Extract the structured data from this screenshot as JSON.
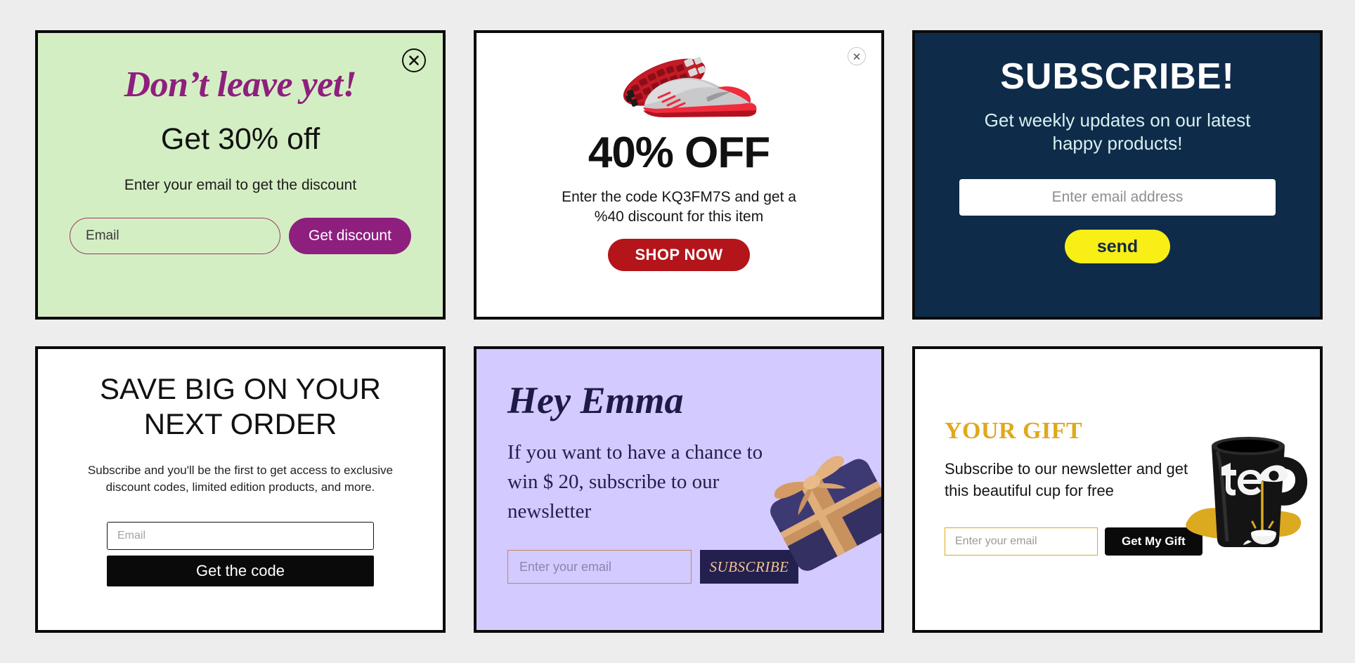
{
  "page": {
    "background_color": "#ededed"
  },
  "cards": [
    {
      "id": "dont-leave-yet",
      "background_color": "#d4eec4",
      "heading": "Don’t leave yet!",
      "subheading": "Get 30% off",
      "body": "Enter your email to get the discount",
      "input_placeholder": "Email",
      "input_value": "",
      "button_label": "Get discount",
      "accent_color": "#8e1f7e",
      "close_icon": "close-icon"
    },
    {
      "id": "forty-percent-off",
      "background_color": "#ffffff",
      "image": "running-shoes-image",
      "heading": "40% OFF",
      "body": "Enter the code KQ3FM7S and get a %40 discount for this item",
      "button_label": "SHOP NOW",
      "accent_color": "#b3151b",
      "close_icon": "close-icon"
    },
    {
      "id": "subscribe",
      "background_color": "#0f2b4a",
      "heading": "SUBSCRIBE!",
      "body": "Get weekly updates on our latest happy products!",
      "input_placeholder": "Enter email address",
      "input_value": "",
      "button_label": "send",
      "accent_color": "#f7ef16"
    },
    {
      "id": "save-big",
      "background_color": "#ffffff",
      "heading": "SAVE BIG ON YOUR NEXT ORDER",
      "body": "Subscribe and you'll be the first to get access to exclusive discount codes, limited edition products, and more.",
      "input_placeholder": "Email",
      "input_value": "",
      "button_label": "Get the code",
      "accent_color": "#0a0a0a"
    },
    {
      "id": "hey-emma",
      "background_color": "#d3caff",
      "heading": "Hey Emma",
      "body": "If you want to have a chance to win $ 20, subscribe to our newsletter",
      "input_placeholder": "Enter your email",
      "input_value": "",
      "button_label": "SUBSCRIBE",
      "accent_color": "#231f4e",
      "image": "gift-box-image"
    },
    {
      "id": "your-gift",
      "background_color": "#ffffff",
      "heading": "YOUR GIFT",
      "body": "Subscribe to our newsletter and get this beautiful cup for free",
      "input_placeholder": "Enter your email",
      "input_value": "",
      "button_label": "Get My Gift",
      "accent_color": "#e0a81c",
      "image": "tea-mug-image",
      "mug_text": "tea"
    }
  ]
}
